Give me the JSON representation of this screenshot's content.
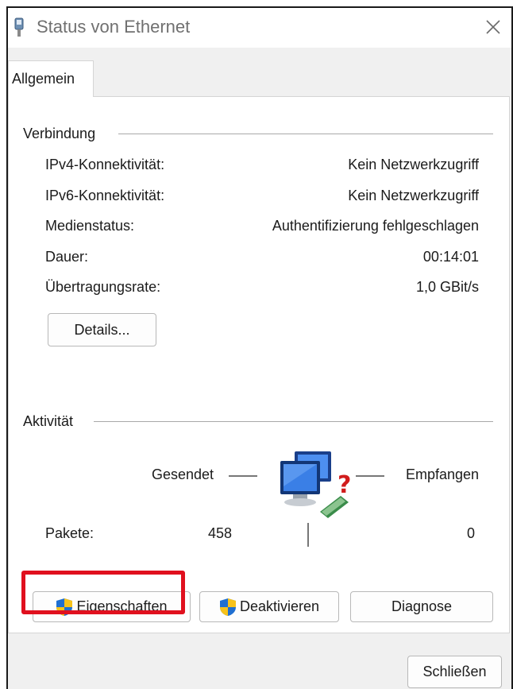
{
  "window": {
    "title": "Status von Ethernet"
  },
  "tabs": [
    {
      "label": "Allgemein"
    }
  ],
  "connection": {
    "group_title": "Verbindung",
    "rows": [
      {
        "label": "IPv4-Konnektivität:",
        "value": "Kein Netzwerkzugriff"
      },
      {
        "label": "IPv6-Konnektivität:",
        "value": "Kein Netzwerkzugriff"
      },
      {
        "label": "Medienstatus:",
        "value": "Authentifizierung fehlgeschlagen"
      },
      {
        "label": "Dauer:",
        "value": "00:14:01"
      },
      {
        "label": "Übertragungsrate:",
        "value": "1,0 GBit/s"
      }
    ],
    "details_button": "Details..."
  },
  "activity": {
    "group_title": "Aktivität",
    "sent_label": "Gesendet",
    "received_label": "Empfangen",
    "packets_label": "Pakete:",
    "packets_sent": "458",
    "packets_received": "0"
  },
  "buttons": {
    "properties": "Eigenschaften",
    "disable": "Deaktivieren",
    "diagnose": "Diagnose",
    "close": "Schließen"
  },
  "colors": {
    "highlight": "#e0101e",
    "shield_blue": "#1f6fd1",
    "shield_yellow": "#f6c21b"
  },
  "icons": [
    "network-adapter-icon",
    "close-icon",
    "uac-shield-icon",
    "network-computers-question-icon"
  ]
}
